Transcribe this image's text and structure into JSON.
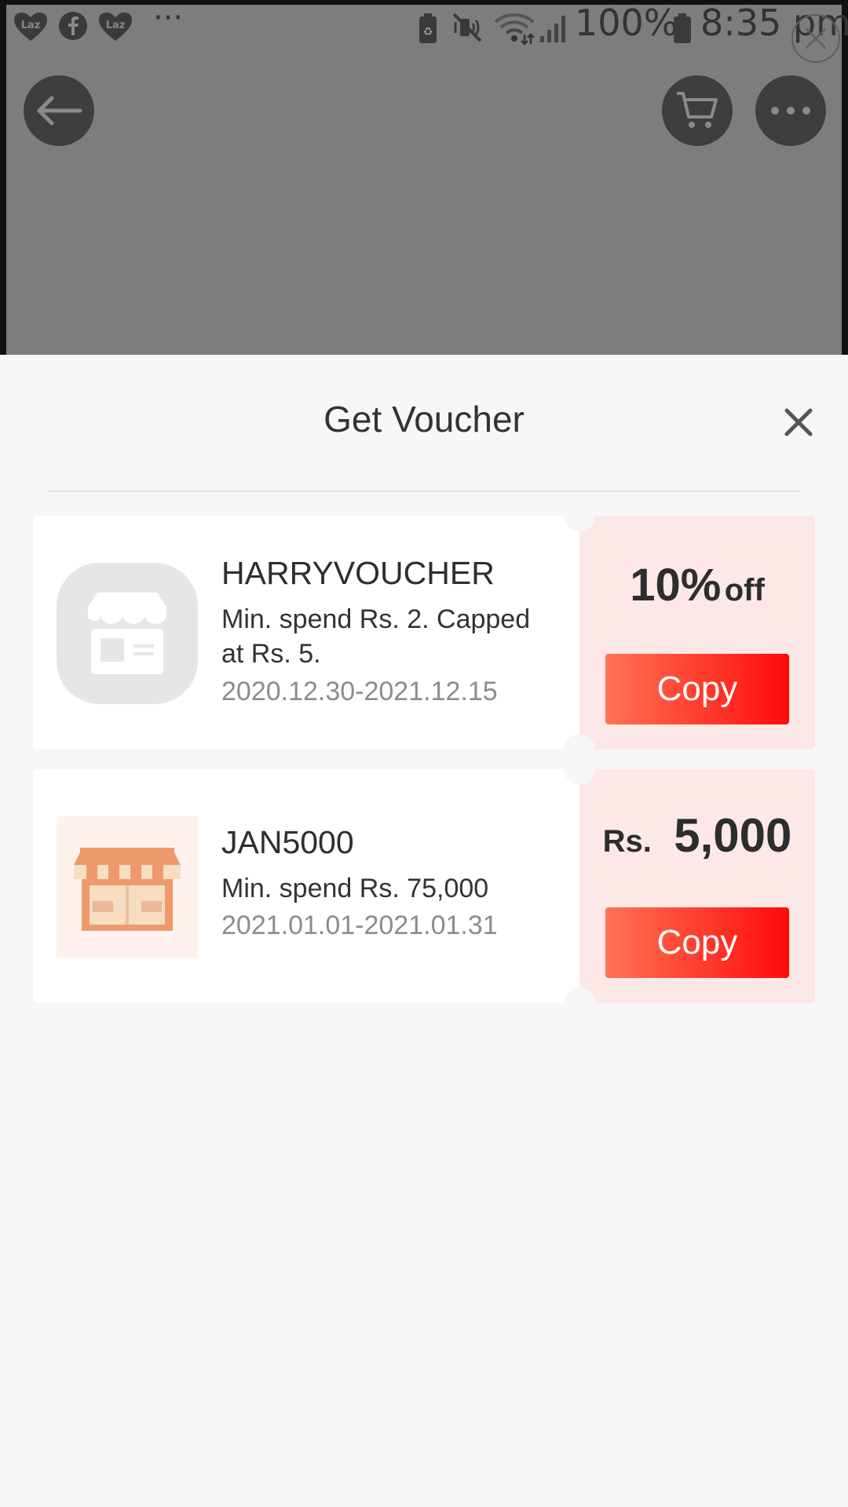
{
  "status_bar": {
    "battery_text": "100%",
    "time": "8:35 pm",
    "overflow": "···",
    "left_icons": [
      "lazada-icon",
      "facebook-icon",
      "lazada-icon"
    ],
    "right_icons": [
      "battery-saver-icon",
      "mute-icon",
      "wifi-icon",
      "signal-icon",
      "battery-icon"
    ]
  },
  "background_page": {
    "buttons": [
      "back-arrow-icon",
      "cart-icon",
      "more-icon"
    ]
  },
  "sheet": {
    "title": "Get Voucher"
  },
  "vouchers": [
    {
      "code": "HARRYVOUCHER",
      "condition": "Min. spend Rs. 2. Capped at Rs. 5.",
      "dates": "2020.12.30-2021.12.15",
      "amount_main": "10%",
      "amount_suffix": "off",
      "copy_label": "Copy",
      "thumb_icon": "store-placeholder-icon"
    },
    {
      "code": "JAN5000",
      "condition": "Min. spend Rs. 75,000",
      "dates": "2021.01.01-2021.01.31",
      "amount_prefix": "Rs.",
      "amount_main": "5,000",
      "copy_label": "Copy",
      "thumb_icon": "shop-icon"
    }
  ],
  "colors": {
    "accent_start": "#ff7455",
    "accent_end": "#ff0a0a",
    "voucher_right_bg": "#fde8e8"
  }
}
